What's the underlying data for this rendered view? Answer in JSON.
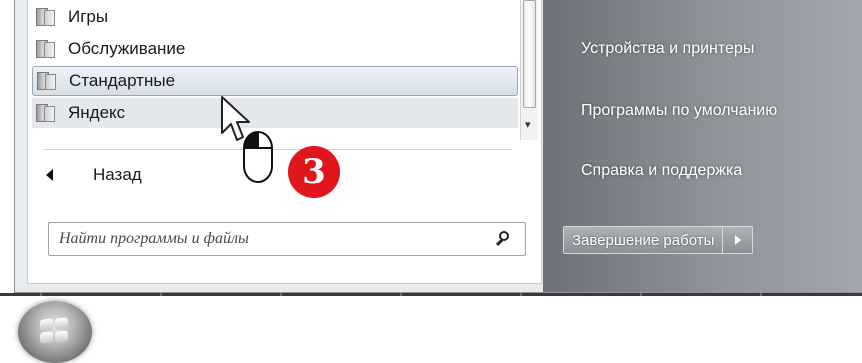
{
  "program_list": {
    "items": [
      {
        "label": "Игры",
        "state": "normal"
      },
      {
        "label": "Обслуживание",
        "state": "normal"
      },
      {
        "label": "Стандартные",
        "state": "selected"
      },
      {
        "label": "Яндекс",
        "state": "hover"
      }
    ]
  },
  "back": {
    "label": "Назад"
  },
  "search": {
    "placeholder": "Найти программы и файлы",
    "icon": "search-icon"
  },
  "right_pane": {
    "links": [
      {
        "label": "Устройства и принтеры"
      },
      {
        "label": "Программы по умолчанию"
      },
      {
        "label": "Справка и поддержка"
      }
    ]
  },
  "shutdown": {
    "label": "Завершение работы",
    "arrow_icon": "chevron-right-icon"
  },
  "annotation": {
    "step_number": "3",
    "badge_color": "#e0161c"
  },
  "colors": {
    "right_pane": "#8f949a",
    "selected_item": "#d6dee6"
  }
}
